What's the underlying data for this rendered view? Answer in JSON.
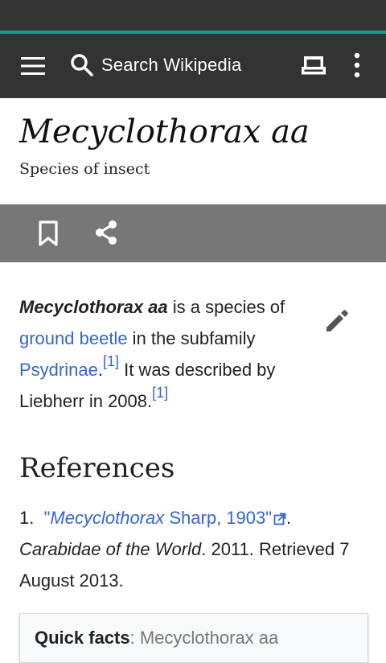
{
  "toolbar": {
    "search_placeholder": "Search Wikipedia"
  },
  "article": {
    "title": "Mecyclothorax aa",
    "description": "Species of insect",
    "lead": {
      "subject": "Mecyclothorax aa",
      "text1": " is a species of ",
      "link1": "ground beetle",
      "text2": " in the subfamily ",
      "link2": "Psydrinae",
      "text3": ".",
      "cite1": "[1]",
      "text4": " It was described by Liebherr in 2008.",
      "cite2": "[1]"
    }
  },
  "references": {
    "heading": "References",
    "items": [
      {
        "num": "1.",
        "quote_open": "\"",
        "link_italic": "Mecyclothorax",
        "link_rest": " Sharp, 1903",
        "quote_close": "\"",
        "after_link": ". ",
        "source": "Carabidae of the World",
        "rest": ". 2011. Retrieved 7 August 2013."
      }
    ]
  },
  "quick_facts": {
    "label": "Quick facts",
    "separator": ": ",
    "value": "Mecyclothorax aa"
  },
  "icons": {
    "menu": "menu-icon",
    "search": "search-icon",
    "reading_lists": "reading-lists-icon",
    "overflow": "more-vert-icon",
    "bookmark": "bookmark-icon",
    "share": "share-icon",
    "edit": "edit-pencil-icon",
    "external_link": "external-link-icon"
  },
  "colors": {
    "toolbar": "#333333",
    "accent": "#14a08c",
    "action_bar": "#777777",
    "link": "#3366cc"
  }
}
